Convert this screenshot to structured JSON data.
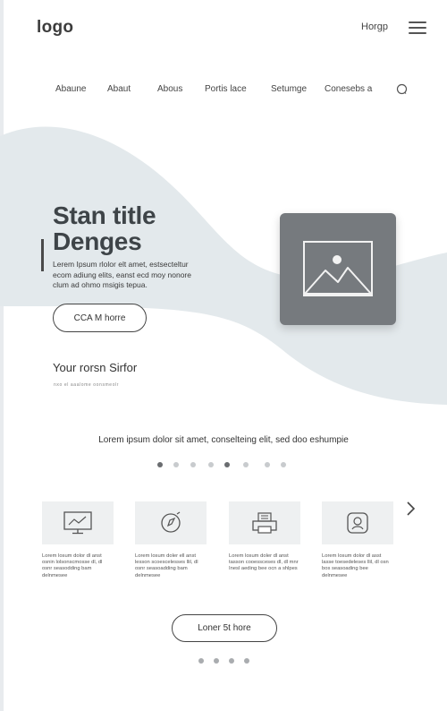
{
  "header": {
    "logo": "logo",
    "top_link": "Horgp",
    "menu_icon": "hamburger-menu-icon"
  },
  "nav": {
    "items": [
      "Abaune",
      "Abaut",
      "Abous",
      "Portis lace",
      "Setumge",
      "Conesebs a"
    ],
    "search_icon": "search-icon"
  },
  "hero": {
    "title_line1": "Stan title",
    "title_line2": "Denges",
    "description": "Lerem Ipsum rlolor elt amet, estsecteltur ecom adiung elits, eanst ecd moy nonore clum ad ohmo msigis tepua.",
    "cta_label": "CCA M horre",
    "image_icon": "image-placeholder-icon",
    "bg_wave_color": "#e3e9ec",
    "image_bg_color": "#767a7e"
  },
  "section": {
    "heading": "Your rorsn Sirfor",
    "caption": "nxo el aaalome oonsmeolr"
  },
  "tagline": "Lorem ipsum dolor sit amet, conselteing elit, sed doo eshumpie",
  "carousel_dots": {
    "count": 8,
    "active": [
      0,
      4
    ]
  },
  "cards": [
    {
      "icon": "monitor-chart-icon",
      "text": "Lorem losum dolor dl anst osnin lolsonscmosse dl, dl osnr seasodding bam delnmesee"
    },
    {
      "icon": "compass-icon",
      "text": "Lorem losum doler ell anst lesson scoescelesses llil, dl osnr seasoadding bam delnmesee"
    },
    {
      "icon": "printer-icon",
      "text": "Lorem losum doler dl anst tasson cooessceses dl, dl mnr Inesl aeding bee ocn a shlpes"
    },
    {
      "icon": "user-frame-icon",
      "text": "Lorem losum dolor dl asst lasse toesedeleses llil, dl osn bos seasoading bee delnmesee"
    }
  ],
  "next_icon": "chevron-right-icon",
  "more_button": "Loner 5t hore",
  "bottom_dots": {
    "count": 4
  }
}
